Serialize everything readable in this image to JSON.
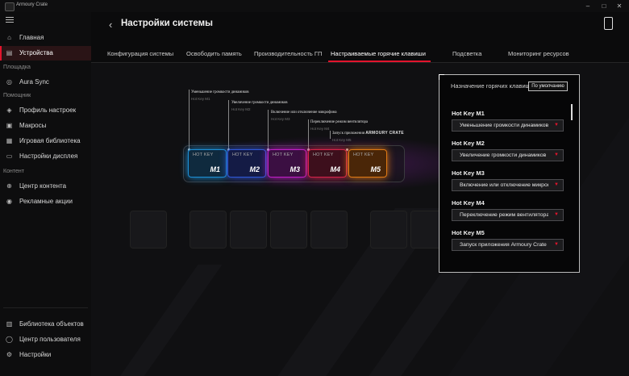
{
  "app": {
    "title": "Armoury Crate"
  },
  "window": {
    "minimize": "–",
    "maximize": "□",
    "close": "✕"
  },
  "sidebar": {
    "top": [
      {
        "label": "Главная",
        "icon": "home-icon",
        "glyph": "⌂"
      },
      {
        "label": "Устройства",
        "icon": "keyboard-icon",
        "glyph": "▤",
        "active": true
      }
    ],
    "section1": "Площадка",
    "section1_items": [
      {
        "label": "Aura Sync",
        "icon": "aura-icon",
        "glyph": "◎"
      }
    ],
    "section2": "Помощник",
    "section2_items": [
      {
        "label": "Профиль настроек",
        "icon": "profile-icon",
        "glyph": "◈"
      },
      {
        "label": "Макросы",
        "icon": "macro-icon",
        "glyph": "▣"
      },
      {
        "label": "Игровая библиотека",
        "icon": "library-icon",
        "glyph": "▦"
      },
      {
        "label": "Настройки дисплея",
        "icon": "display-icon",
        "glyph": "▭"
      }
    ],
    "section3": "Контент",
    "section3_items": [
      {
        "label": "Центр контента",
        "icon": "content-icon",
        "glyph": "⊕"
      },
      {
        "label": "Рекламные акции",
        "icon": "promo-icon",
        "glyph": "◉"
      }
    ],
    "bottom": [
      {
        "label": "Библиотека объектов",
        "icon": "object-library-icon",
        "glyph": "▥"
      },
      {
        "label": "Центр пользователя",
        "icon": "user-icon",
        "glyph": "◯"
      },
      {
        "label": "Настройки",
        "icon": "gear-icon",
        "glyph": "⚙"
      }
    ]
  },
  "header": {
    "back": "‹",
    "title": "Настройки системы"
  },
  "tabs": [
    "Конфигурация системы",
    "Освободить память",
    "Производительность ГП",
    "Настраиваемые горячие клавиши",
    "Подсветка",
    "Мониторинг ресурсов"
  ],
  "active_tab": 3,
  "keys": [
    {
      "hk": "HOT KEY",
      "m": "M1",
      "color": "#1d8fd6",
      "callout": "Уменьшение громкости динамиков",
      "sub": "Hot Key M1"
    },
    {
      "hk": "HOT KEY",
      "m": "M2",
      "color": "#2f58d8",
      "callout": "Увеличение громкости динамиков",
      "sub": "Hot Key M2"
    },
    {
      "hk": "HOT KEY",
      "m": "M3",
      "color": "#c21fc9",
      "callout": "Включение или отключение микрофона",
      "sub": "Hot Key M3"
    },
    {
      "hk": "HOT KEY",
      "m": "M4",
      "color": "#d6244a",
      "callout": "Переключение режим вентилятора",
      "sub": "Hot Key M4"
    },
    {
      "hk": "HOT KEY",
      "m": "M5",
      "color": "#e07a14",
      "callout": "Запуск приложения",
      "callout_brand": "ARMOURY CRATE",
      "sub": "Hot Key M5"
    }
  ],
  "panel": {
    "title": "Назначение горячих клавиш",
    "default_button": "По умолчанию",
    "items": [
      {
        "label": "Hot Key M1",
        "value": "Уменьшение громкости динамиков"
      },
      {
        "label": "Hot Key M2",
        "value": "Увеличение громкости динамиков"
      },
      {
        "label": "Hot Key M3",
        "value": "Включение или отключение микрофона"
      },
      {
        "label": "Hot Key M4",
        "value": "Переключение режим вентилятора"
      },
      {
        "label": "Hot Key M5",
        "value": "Запуск приложения Armoury Crate"
      }
    ],
    "dropdown_arrow": "▼"
  },
  "colors": {
    "accent": "#e2142d"
  }
}
